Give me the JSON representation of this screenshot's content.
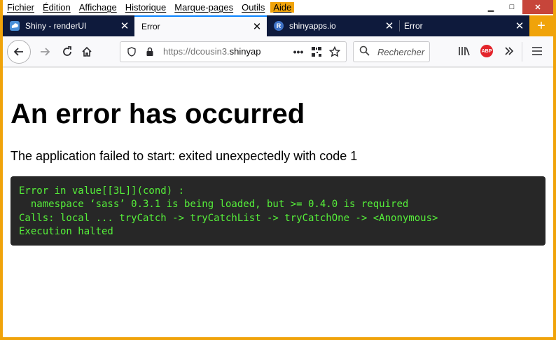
{
  "menu": {
    "items": [
      "Fichier",
      "Édition",
      "Affichage",
      "Historique",
      "Marque-pages",
      "Outils",
      "Aide"
    ]
  },
  "window_controls": {
    "minimize": "▁",
    "maximize": "□",
    "close": "✕"
  },
  "tabs": [
    {
      "label": "Shiny - renderUI",
      "icon": "shiny-icon",
      "active": false
    },
    {
      "label": "Error",
      "icon": "",
      "active": true
    },
    {
      "label": "shinyapps.io",
      "icon": "r-icon",
      "favicon_letter": "R",
      "active": false
    },
    {
      "label": "Error",
      "icon": "",
      "active": false
    }
  ],
  "new_tab_label": "+",
  "tab_close_label": "✕",
  "navbar": {
    "url_prefix": "https://dcousin3.",
    "url_highlight": "shinyap",
    "search_placeholder": "Rechercher",
    "page_actions_label": "•••",
    "abp_label": "ABP"
  },
  "content": {
    "title": "An error has occurred",
    "message": "The application failed to start: exited unexpectedly with code 1",
    "error_log": "Error in value[[3L]](cond) :\n  namespace ‘sass’ 0.3.1 is being loaded, but >= 0.4.0 is required\nCalls: local ... tryCatch -> tryCatchList -> tryCatchOne -> <Anonymous>\nExecution halted"
  },
  "colors": {
    "accent": "#0a84ff",
    "tab_strip": "#0e1a3c",
    "window_frame": "#f0a30a",
    "error_text": "#56f03a",
    "error_bg": "#272727"
  }
}
